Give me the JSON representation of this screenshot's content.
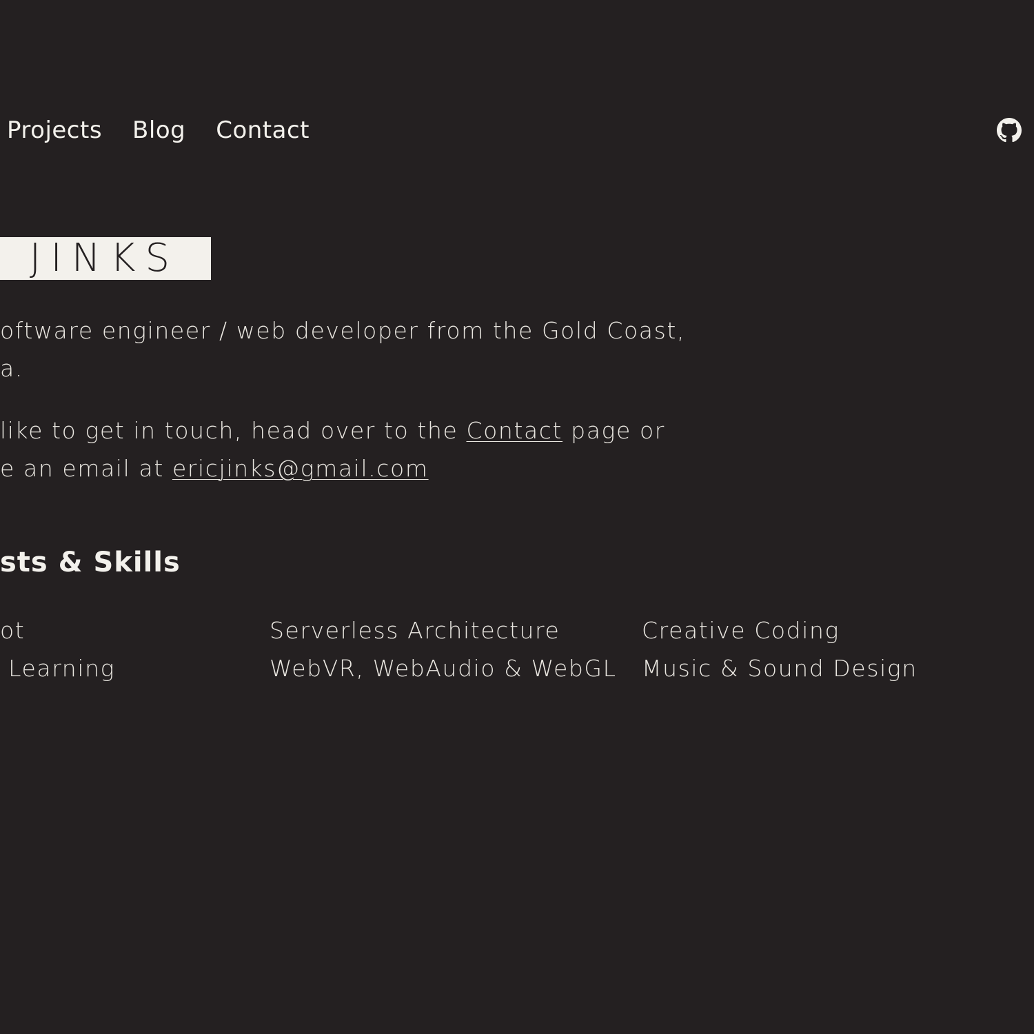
{
  "nav": {
    "items": [
      {
        "label": "Projects"
      },
      {
        "label": "Blog"
      },
      {
        "label": "Contact"
      }
    ],
    "github_icon": "github-icon"
  },
  "hero": {
    "name": "C JINKS"
  },
  "intro": {
    "line1": "oftware engineer / web developer from the Gold Coast,",
    "line2": "a.",
    "contact_line1_before": "like to get in touch, head over to the ",
    "contact_link": "Contact",
    "contact_line1_after": " page or",
    "contact_line2_before": "e an email at ",
    "email_link": "ericjinks@gmail.com"
  },
  "skills": {
    "heading": "sts & Skills",
    "col1": [
      "ot",
      " Learning"
    ],
    "col2": [
      "Serverless Architecture",
      "WebVR, WebAudio & WebGL"
    ],
    "col3": [
      "Creative Coding",
      "Music & Sound Design"
    ]
  },
  "colors": {
    "background": "#242021",
    "text": "#f3f1ec"
  }
}
